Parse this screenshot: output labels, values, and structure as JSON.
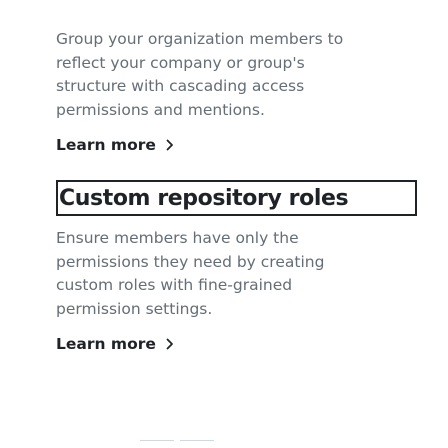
{
  "teams_section": {
    "description": "Group your organization members to reflect your company or group's structure with cascading access permissions and mentions.",
    "learn_more_label": "Learn more"
  },
  "roles_section": {
    "title": "Custom repository roles",
    "description": "Ensure members have only the permissions they need by creating custom roles with fine-grained permission settings.",
    "learn_more_label": "Learn more"
  },
  "icons": {
    "learn_more_icon": "chevron-right-icon"
  },
  "colors": {
    "heading_text": "#1f2328",
    "body_text": "#656d76",
    "focus_outline": "#1f2328"
  }
}
